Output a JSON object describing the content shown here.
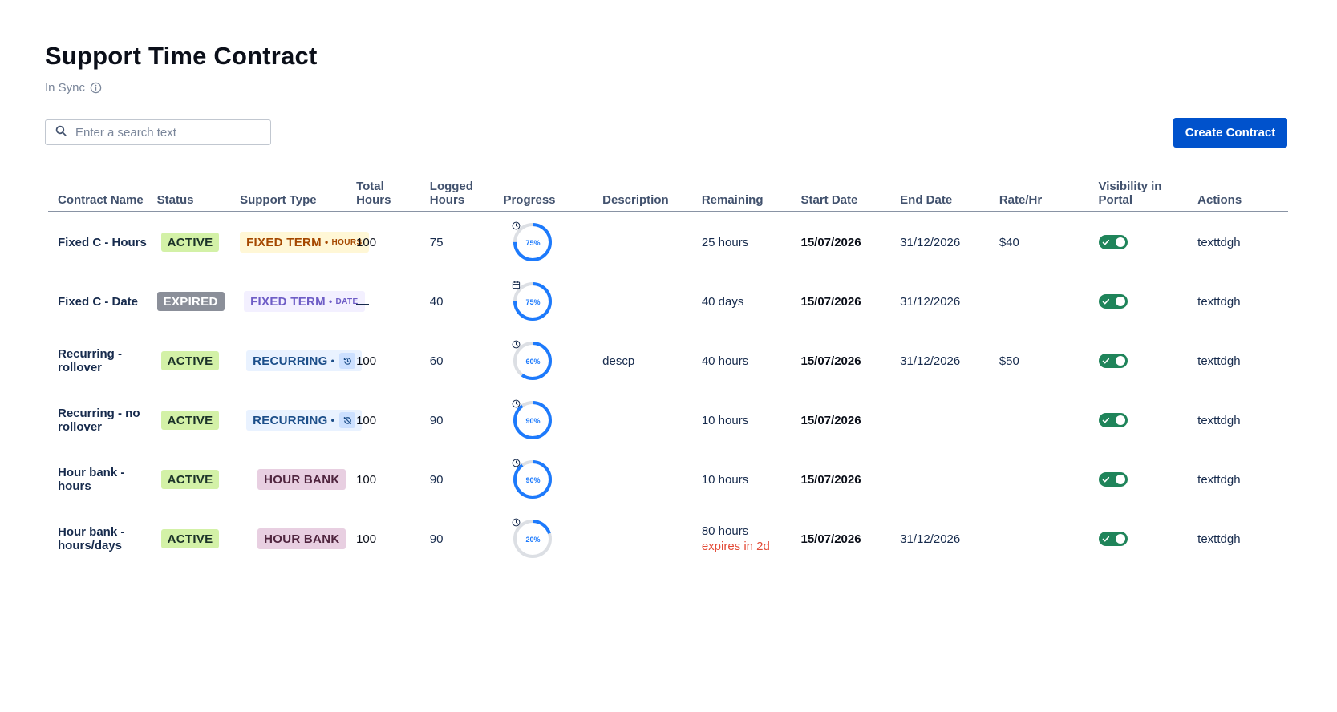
{
  "page": {
    "title": "Support Time Contract",
    "sync_status": "In Sync"
  },
  "search": {
    "placeholder": "Enter a search text",
    "value": ""
  },
  "toolbar": {
    "create_label": "Create Contract"
  },
  "colors": {
    "primary": "#0052cc",
    "active_bg": "#d3f1a7",
    "expired_bg": "#8b8f99",
    "toggle_on": "#1f845a",
    "ring_fill": "#1d7afc",
    "ring_track": "#dcdfe4",
    "danger": "#e34935"
  },
  "table": {
    "headers": [
      "Contract Name",
      "Status",
      "Support Type",
      "Total Hours",
      "Logged Hours",
      "Progress",
      "Description",
      "Remaining",
      "Start Date",
      "End Date",
      "Rate/Hr",
      "Visibility in Portal",
      "Actions"
    ],
    "rows": [
      {
        "name": "Fixed C - Hours",
        "status": "ACTIVE",
        "support_main": "FIXED TERM",
        "support_sub": "HOURS",
        "support_icon": "",
        "total": "100",
        "logged": "75",
        "progress": 75,
        "progress_label": "75%",
        "progress_icon": "clock-icon",
        "description": "",
        "remaining": "25 hours",
        "remaining_note": "",
        "start": "15/07/2026",
        "end": "31/12/2026",
        "rate": "$40",
        "visible": true,
        "action": "texttdgh"
      },
      {
        "name": "Fixed C - Date",
        "status": "EXPIRED",
        "support_main": "FIXED TERM",
        "support_sub": "DATE",
        "support_icon": "",
        "total": "",
        "logged": "40",
        "progress": 75,
        "progress_label": "75%",
        "progress_icon": "calendar-icon",
        "description": "",
        "remaining": "40 days",
        "remaining_note": "",
        "start": "15/07/2026",
        "end": "31/12/2026",
        "rate": "",
        "visible": true,
        "action": "texttdgh"
      },
      {
        "name": "Recurring - rollover",
        "status": "ACTIVE",
        "support_main": "RECURRING",
        "support_sub": "",
        "support_icon": "rollover-icon",
        "total": "100",
        "logged": "60",
        "progress": 60,
        "progress_label": "60%",
        "progress_icon": "clock-icon",
        "description": "descp",
        "remaining": "40 hours",
        "remaining_note": "",
        "start": "15/07/2026",
        "end": "31/12/2026",
        "rate": "$50",
        "visible": true,
        "action": "texttdgh"
      },
      {
        "name": "Recurring - no rollover",
        "status": "ACTIVE",
        "support_main": "RECURRING",
        "support_sub": "",
        "support_icon": "no-rollover-icon",
        "total": "100",
        "logged": "90",
        "progress": 90,
        "progress_label": "90%",
        "progress_icon": "clock-icon",
        "description": "",
        "remaining": "10 hours",
        "remaining_note": "",
        "start": "15/07/2026",
        "end": "",
        "rate": "",
        "visible": true,
        "action": "texttdgh"
      },
      {
        "name": "Hour bank - hours",
        "status": "ACTIVE",
        "support_main": "HOUR BANK",
        "support_sub": "",
        "support_icon": "",
        "total": "100",
        "logged": "90",
        "progress": 90,
        "progress_label": "90%",
        "progress_icon": "clock-icon",
        "description": "",
        "remaining": "10 hours",
        "remaining_note": "",
        "start": "15/07/2026",
        "end": "",
        "rate": "",
        "visible": true,
        "action": "texttdgh"
      },
      {
        "name": "Hour bank - hours/days",
        "status": "ACTIVE",
        "support_main": "HOUR BANK",
        "support_sub": "",
        "support_icon": "",
        "total": "100",
        "logged": "90",
        "progress": 20,
        "progress_label": "20%",
        "progress_icon": "clock-icon",
        "description": "",
        "remaining": "80 hours",
        "remaining_note": "expires in 2d",
        "start": "15/07/2026",
        "end": "31/12/2026",
        "rate": "",
        "visible": true,
        "action": "texttdgh"
      }
    ]
  }
}
